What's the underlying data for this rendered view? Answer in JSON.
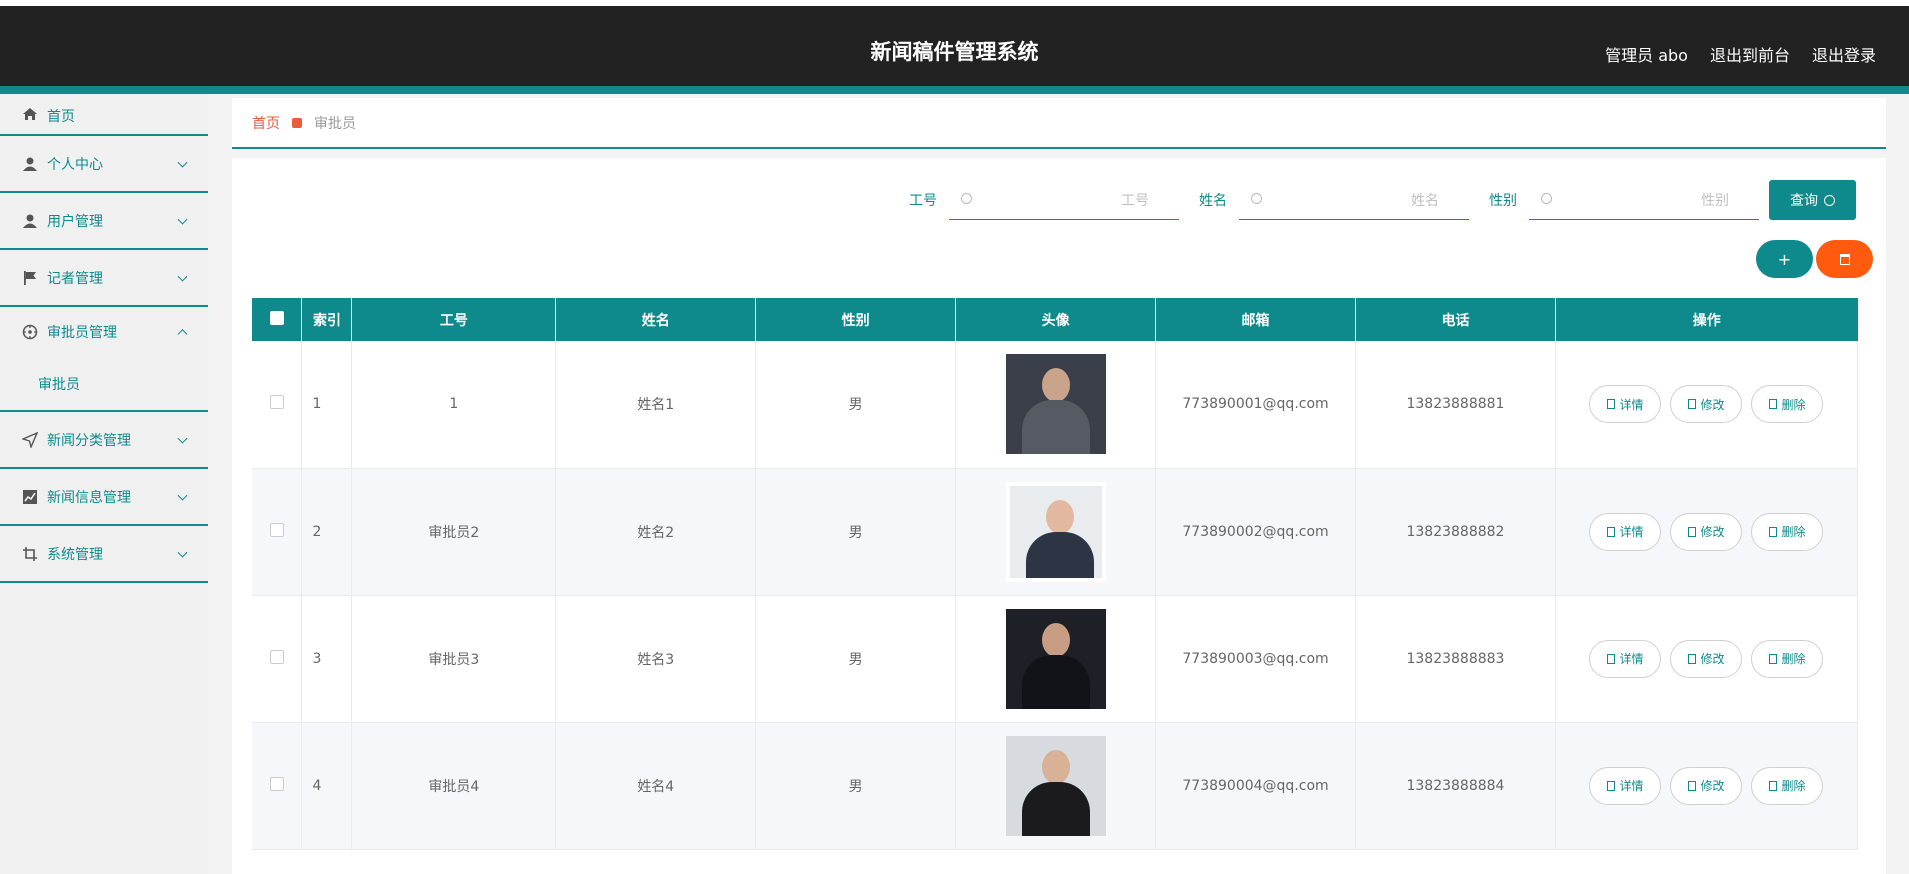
{
  "header": {
    "title": "新闻稿件管理系统",
    "admin": "管理员 abo",
    "to_frontend": "退出到前台",
    "logout": "退出登录"
  },
  "sidebar": {
    "items": [
      {
        "label": "首页",
        "icon": "home-icon"
      },
      {
        "label": "个人中心",
        "icon": "user-icon"
      },
      {
        "label": "用户管理",
        "icon": "user-icon"
      },
      {
        "label": "记者管理",
        "icon": "flag-icon"
      },
      {
        "label": "审批员管理",
        "icon": "compass-icon",
        "open": true,
        "children": [
          "审批员"
        ]
      },
      {
        "label": "新闻分类管理",
        "icon": "send-icon"
      },
      {
        "label": "新闻信息管理",
        "icon": "chart-icon"
      },
      {
        "label": "系统管理",
        "icon": "crop-icon"
      }
    ]
  },
  "breadcrumb": {
    "home": "首页",
    "current": "审批员"
  },
  "search": {
    "fields": [
      {
        "label": "工号",
        "placeholder": "工号"
      },
      {
        "label": "姓名",
        "placeholder": "姓名"
      },
      {
        "label": "性别",
        "placeholder": "性别"
      }
    ],
    "query_label": "查询"
  },
  "actions": {
    "add_label": "+"
  },
  "table": {
    "columns": [
      "索引",
      "工号",
      "姓名",
      "性别",
      "头像",
      "邮箱",
      "电话",
      "操作"
    ],
    "rows": [
      {
        "index": "1",
        "id": "1",
        "name": "姓名1",
        "gender": "男",
        "email": "773890001@qq.com",
        "phone": "13823888881"
      },
      {
        "index": "2",
        "id": "审批员2",
        "name": "姓名2",
        "gender": "男",
        "email": "773890002@qq.com",
        "phone": "13823888882"
      },
      {
        "index": "3",
        "id": "审批员3",
        "name": "姓名3",
        "gender": "男",
        "email": "773890003@qq.com",
        "phone": "13823888883"
      },
      {
        "index": "4",
        "id": "审批员4",
        "name": "姓名4",
        "gender": "男",
        "email": "773890004@qq.com",
        "phone": "13823888884"
      }
    ],
    "op_labels": {
      "detail": "详情",
      "edit": "修改",
      "delete": "删除"
    }
  },
  "colors": {
    "accent": "#0f8a8c",
    "danger": "#ff5a0e",
    "topbar": "#222222"
  }
}
